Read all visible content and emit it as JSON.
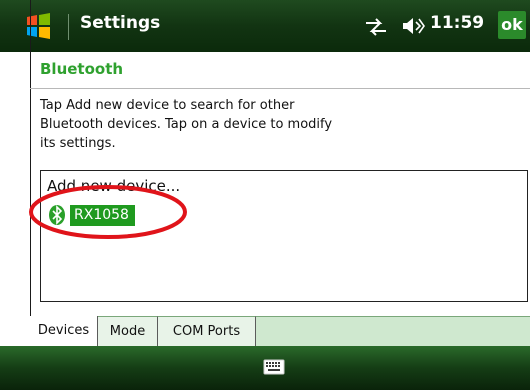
{
  "titlebar": {
    "title": "Settings",
    "time": "11:59",
    "ok_label": "ok",
    "icons": [
      "windows-start-icon",
      "connectivity-icon",
      "volume-icon"
    ]
  },
  "page": {
    "heading": "Bluetooth",
    "instructions_lines": [
      "Tap Add new device to search for other",
      "Bluetooth devices. Tap on a device to modify",
      "its settings."
    ]
  },
  "device_list": {
    "add_label": "Add new device...",
    "devices": [
      {
        "name": "RX1058",
        "icon": "bluetooth-icon",
        "selected": true
      }
    ]
  },
  "tabs": [
    {
      "label": "Devices",
      "active": true
    },
    {
      "label": "Mode",
      "active": false
    },
    {
      "label": "COM Ports",
      "active": false
    }
  ],
  "bottombar": {
    "icons": [
      "keyboard-icon"
    ]
  },
  "colors": {
    "titlebar": "#123412",
    "accent": "#2fa12f",
    "selection": "#1f9a1f",
    "annotation": "#e0141a",
    "tab_background": "#cfe8cf"
  }
}
